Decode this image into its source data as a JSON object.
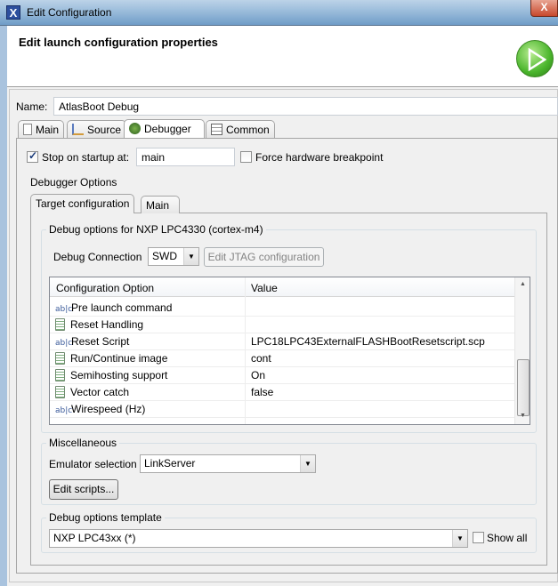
{
  "window": {
    "title": "Edit Configuration",
    "close": "X",
    "app_icon": "X"
  },
  "header": {
    "title": "Edit launch configuration properties",
    "icon": "run-icon"
  },
  "name": {
    "label": "Name:",
    "value": "AtlasBoot Debug"
  },
  "tabs": [
    {
      "label": "Main",
      "icon": "file-icon"
    },
    {
      "label": "Source",
      "icon": "source-icon"
    },
    {
      "label": "Debugger",
      "icon": "bug-icon",
      "selected": true
    },
    {
      "label": "Common",
      "icon": "table-icon"
    }
  ],
  "debugger": {
    "stop_on_startup": {
      "label": "Stop on startup at:",
      "checked": true,
      "value": "main"
    },
    "force_hw_bp": {
      "label": "Force hardware breakpoint",
      "checked": false
    },
    "options_label": "Debugger Options",
    "inner_tabs": [
      {
        "label": "Target configuration",
        "selected": true
      },
      {
        "label": "Main"
      }
    ],
    "debug_options_group": "Debug options for NXP LPC4330 (cortex-m4)",
    "debug_connection": {
      "label": "Debug Connection",
      "value": "SWD"
    },
    "edit_jtag_button": "Edit JTAG configuration",
    "table": {
      "columns": [
        "Configuration Option",
        "Value"
      ],
      "rows": [
        {
          "option": "Pre launch command",
          "value": "",
          "icon": "text-icon"
        },
        {
          "option": "Reset Handling",
          "value": "",
          "icon": "list-icon"
        },
        {
          "option": "Reset Script",
          "value": "LPC18LPC43ExternalFLASHBootResetscript.scp",
          "icon": "text-icon"
        },
        {
          "option": "Run/Continue image",
          "value": "cont",
          "icon": "list-icon"
        },
        {
          "option": "Semihosting support",
          "value": "On",
          "icon": "list-icon"
        },
        {
          "option": "Vector catch",
          "value": "false",
          "icon": "list-icon"
        },
        {
          "option": "Wirespeed (Hz)",
          "value": "",
          "icon": "text-icon"
        }
      ]
    },
    "misc": {
      "label": "Miscellaneous",
      "emulator_label": "Emulator selection",
      "emulator_value": "LinkServer",
      "edit_scripts": "Edit scripts..."
    },
    "template": {
      "label": "Debug options template",
      "value": "NXP LPC43xx (*)",
      "show_all": "Show all",
      "show_all_checked": false
    }
  }
}
